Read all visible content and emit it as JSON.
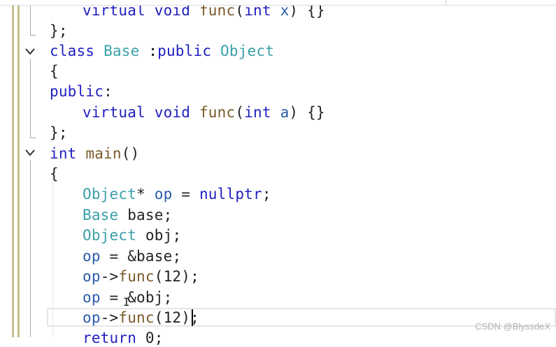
{
  "code": {
    "lines": [
      {
        "tokens": [
          {
            "t": "virtual",
            "c": "kw"
          },
          {
            "t": " "
          },
          {
            "t": "void",
            "c": "kw"
          },
          {
            "t": " "
          },
          {
            "t": "func",
            "c": "fn"
          },
          {
            "t": "(",
            "c": "punc"
          },
          {
            "t": "int",
            "c": "kw"
          },
          {
            "t": " "
          },
          {
            "t": "x",
            "c": "var"
          },
          {
            "t": ") {}",
            "c": "punc"
          }
        ]
      },
      {
        "tokens": [
          {
            "t": "};",
            "c": "punc"
          }
        ]
      },
      {
        "tokens": [
          {
            "t": "class",
            "c": "kw"
          },
          {
            "t": " "
          },
          {
            "t": "Base",
            "c": "cls"
          },
          {
            "t": " :"
          },
          {
            "t": "public",
            "c": "kw"
          },
          {
            "t": " "
          },
          {
            "t": "Object",
            "c": "cls"
          }
        ]
      },
      {
        "tokens": [
          {
            "t": "{",
            "c": "punc"
          }
        ]
      },
      {
        "tokens": [
          {
            "t": "public",
            "c": "kw"
          },
          {
            "t": ":",
            "c": "punc"
          }
        ]
      },
      {
        "tokens": [
          {
            "t": "virtual",
            "c": "kw"
          },
          {
            "t": " "
          },
          {
            "t": "void",
            "c": "kw"
          },
          {
            "t": " "
          },
          {
            "t": "func",
            "c": "fn"
          },
          {
            "t": "(",
            "c": "punc"
          },
          {
            "t": "int",
            "c": "kw"
          },
          {
            "t": " "
          },
          {
            "t": "a",
            "c": "var"
          },
          {
            "t": ") {}",
            "c": "punc"
          }
        ]
      },
      {
        "tokens": [
          {
            "t": "};",
            "c": "punc"
          }
        ]
      },
      {
        "tokens": [
          {
            "t": "int",
            "c": "kw"
          },
          {
            "t": " "
          },
          {
            "t": "main",
            "c": "fn"
          },
          {
            "t": "()",
            "c": "punc"
          }
        ]
      },
      {
        "tokens": [
          {
            "t": "{",
            "c": "punc"
          }
        ]
      },
      {
        "tokens": [
          {
            "t": "Object",
            "c": "cls"
          },
          {
            "t": "* ",
            "c": "op"
          },
          {
            "t": "op",
            "c": "var"
          },
          {
            "t": " = ",
            "c": "op"
          },
          {
            "t": "nullptr",
            "c": "kw"
          },
          {
            "t": ";",
            "c": "punc"
          }
        ]
      },
      {
        "tokens": [
          {
            "t": "Base",
            "c": "cls"
          },
          {
            "t": " "
          },
          {
            "t": "base",
            "c": "op"
          },
          {
            "t": ";",
            "c": "punc"
          }
        ]
      },
      {
        "tokens": [
          {
            "t": "Object",
            "c": "cls"
          },
          {
            "t": " "
          },
          {
            "t": "obj",
            "c": "op"
          },
          {
            "t": ";",
            "c": "punc"
          }
        ]
      },
      {
        "tokens": [
          {
            "t": "op",
            "c": "var"
          },
          {
            "t": " = ",
            "c": "op"
          },
          {
            "t": "&base",
            "c": "op"
          },
          {
            "t": ";",
            "c": "punc"
          }
        ]
      },
      {
        "tokens": [
          {
            "t": "op",
            "c": "var"
          },
          {
            "t": "->",
            "c": "op"
          },
          {
            "t": "func",
            "c": "fn"
          },
          {
            "t": "(12);",
            "c": "punc"
          }
        ]
      },
      {
        "tokens": [
          {
            "t": "op",
            "c": "var"
          },
          {
            "t": " = ",
            "c": "op"
          },
          {
            "t": "&obj",
            "c": "op"
          },
          {
            "t": ";",
            "c": "punc"
          }
        ]
      },
      {
        "tokens": [
          {
            "t": "op",
            "c": "var"
          },
          {
            "t": "->",
            "c": "op"
          },
          {
            "t": "func",
            "c": "fn"
          },
          {
            "t": "(12);",
            "c": "punc"
          }
        ]
      },
      {
        "tokens": [
          {
            "t": "return",
            "c": "kw"
          },
          {
            "t": " "
          },
          {
            "t": "0;",
            "c": "punc"
          }
        ]
      }
    ]
  },
  "cursor_glyph": "I",
  "watermark": "CSDN @BlyssdeX",
  "colors": {
    "keyword": "#2020c0",
    "class_name": "#3aa0a8",
    "function": "#7a5a2a",
    "variable": "#2a5aa8",
    "change_bar": "#c4c08a"
  }
}
